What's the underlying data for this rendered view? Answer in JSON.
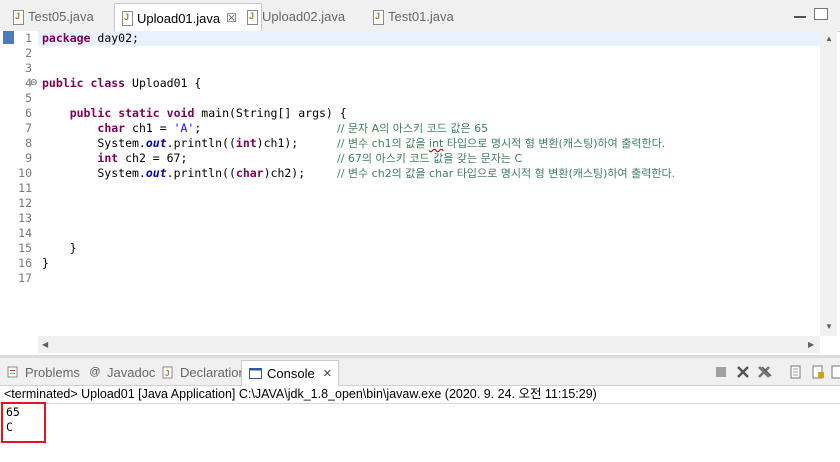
{
  "editor": {
    "tabs": [
      {
        "label": "Test05.java",
        "active": false
      },
      {
        "label": "Upload01.java",
        "active": true,
        "close": "☒"
      },
      {
        "label": "Upload02.java",
        "active": false
      },
      {
        "label": "Test01.java",
        "active": false
      }
    ],
    "line_numbers": [
      "1",
      "2",
      "3",
      "4",
      "5",
      "6",
      "7",
      "8",
      "9",
      "10",
      "11",
      "12",
      "13",
      "14",
      "15",
      "16",
      "17"
    ],
    "fold_marker": "⊖",
    "code": {
      "l1_kw": "package",
      "l1_rest": " day02;",
      "l4_kw1": "public",
      "l4_kw2": "class",
      "l4_rest": " Upload01 {",
      "l6_indent": "    ",
      "l6_kw1": "public",
      "l6_kw2": "static",
      "l6_kw3": "void",
      "l6_rest": " main(String[] args) {",
      "l7_indent": "        ",
      "l7_kw": "char",
      "l7_mid": " ch1 = ",
      "l7_str": "'A'",
      "l7_end": ";",
      "l7_comment": "// 문자 A의 아스키 코드 값은 65",
      "l8_a": "        System.",
      "l8_out": "out",
      "l8_b": ".println((",
      "l8_kw": "int",
      "l8_c": ")ch1);",
      "l8_comment_a": "// 변수 ch1의 값을 ",
      "l8_comment_int": "int",
      "l8_comment_b": " 타입으로 명시적 형 변환(캐스팅)하여 출력한다.",
      "l9_indent": "        ",
      "l9_kw": "int",
      "l9_rest": " ch2 = 67;",
      "l9_comment": "// 67의 아스키 코드 값을 갖는 문자는 C",
      "l10_a": "        System.",
      "l10_out": "out",
      "l10_b": ".println((",
      "l10_kw": "char",
      "l10_c": ")ch2);",
      "l10_comment": "// 변수 ch2의 값을 char 타입으로 명시적 형 변환(캐스팅)하여 출력한다.",
      "l15": "    }",
      "l16": "}"
    }
  },
  "views": {
    "tabs": [
      {
        "label": "Problems",
        "icon": "problems-icon"
      },
      {
        "label": "Javadoc",
        "icon": "javadoc-icon",
        "glyph": "@"
      },
      {
        "label": "Declaration",
        "icon": "declaration-icon"
      },
      {
        "label": "Console",
        "icon": "console-icon",
        "active": true,
        "close": "✕"
      }
    ]
  },
  "console": {
    "status": "<terminated> Upload01 [Java Application] C:\\JAVA\\jdk_1.8_open\\bin\\javaw.exe (2020. 9. 24. 오전 11:15:29)",
    "output": [
      "65",
      "C"
    ]
  },
  "colors": {
    "keyword": "#7f0055",
    "string": "#2a00ff",
    "static_field": "#0000c0",
    "comment": "#3f7f5f",
    "highlight_box": "#e8141b"
  }
}
